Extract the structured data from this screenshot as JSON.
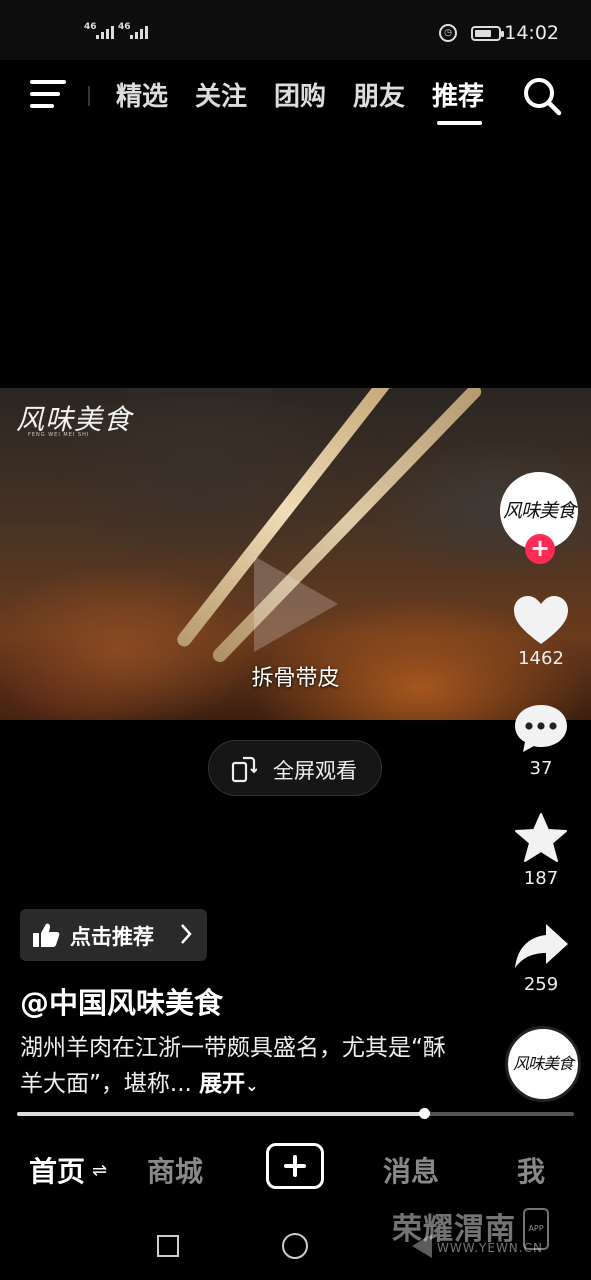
{
  "status_bar": {
    "signal1": "46",
    "signal2": "46",
    "time": "14:02"
  },
  "top_nav": {
    "tabs": [
      {
        "label": "精选"
      },
      {
        "label": "关注"
      },
      {
        "label": "团购"
      },
      {
        "label": "朋友"
      },
      {
        "label": "推荐",
        "active": true
      }
    ]
  },
  "video": {
    "watermark_logo": "风味美食",
    "watermark_sub": "FENG WEI MEI SHI",
    "subtitle": "拆骨带皮",
    "fullscreen_label": "全屏观看"
  },
  "side_rail": {
    "avatar_text": "风味美食",
    "follow_symbol": "+",
    "likes": "1462",
    "comments": "37",
    "favorites": "187",
    "shares": "259",
    "music_disc_text": "风味美食"
  },
  "info": {
    "recommend_label": "点击推荐",
    "author": "@中国风味美食",
    "description": "湖州羊肉在江浙一带颇具盛名，尤其是“酥羊大面”，堪称...",
    "expand_label": "展开",
    "progress_fraction": 0.73
  },
  "bottom_nav": {
    "home": "首页",
    "home_switch": "⇌",
    "mall": "商城",
    "messages": "消息",
    "me": "我"
  },
  "watermark": {
    "brand": "荣耀渭南",
    "url": "WWW.YEWN.CN",
    "app": "APP"
  }
}
